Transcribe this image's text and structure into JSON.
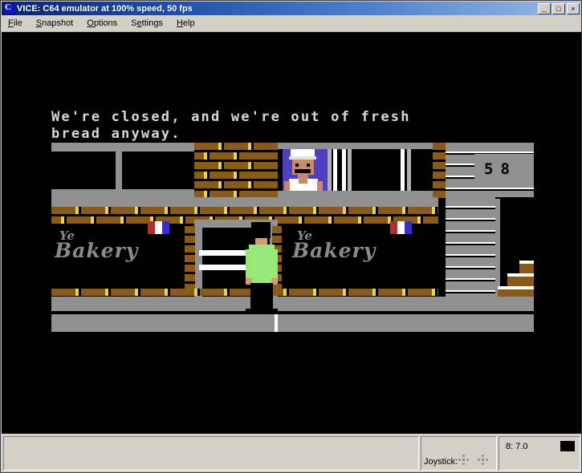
{
  "window": {
    "title": "VICE: C64 emulator at 100% speed, 50 fps",
    "icon": "commodore-icon",
    "buttons": {
      "minimize": "_",
      "maximize": "□",
      "close": "×"
    }
  },
  "menubar": {
    "items": [
      {
        "label": "File",
        "accel": "F"
      },
      {
        "label": "Snapshot",
        "accel": "S"
      },
      {
        "label": "Options",
        "accel": "O"
      },
      {
        "label": "Settings",
        "accel": "S"
      },
      {
        "label": "Help",
        "accel": "H"
      }
    ]
  },
  "game": {
    "dialogue_line1": "We're closed, and we're out of fresh",
    "dialogue_line2": "bread anyway.",
    "score": "58",
    "sign_left": {
      "word1": "Ye",
      "word2": "Bakery"
    },
    "sign_right": {
      "word1": "Ye",
      "word2": "Bakery"
    },
    "flag_colors": [
      "#a83232",
      "#ffffff",
      "#3a30c8"
    ],
    "palette": {
      "background": "#000000",
      "brick": "#8a5a18",
      "brick_highlight": "#e8d44c",
      "stone": "#909090",
      "player_shirt": "#96e878",
      "player_trousers": "#000000",
      "player_hair": "#000000",
      "player_skin": "#d89878",
      "baker_background": "#5040c0",
      "baker_shirt": "#ffffff",
      "baker_skin": "#c88a68",
      "text": "#d8d8d8"
    }
  },
  "statusbar": {
    "joystick_label": "Joystick:",
    "drive_label": "8: 7.0",
    "drive_led_color": "#000000"
  }
}
